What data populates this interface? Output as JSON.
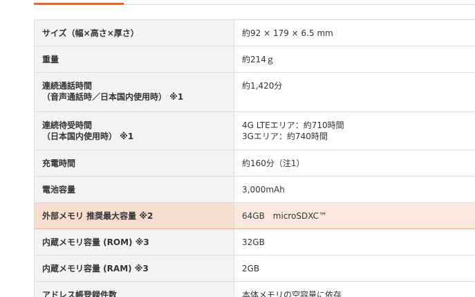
{
  "spec_rows": [
    {
      "label": [
        "サイズ（幅×高さ×厚さ）"
      ],
      "value": [
        "約92 × 179 × 6.5 mm"
      ]
    },
    {
      "label": [
        "重量"
      ],
      "value": [
        "約214ｇ"
      ]
    },
    {
      "label": [
        "連続通話時間",
        "（音声通話時／日本国内使用時） ※1"
      ],
      "value": [
        "約1,420分"
      ]
    },
    {
      "label": [
        "連続待受時間",
        "（日本国内使用時） ※1"
      ],
      "value": [
        "4G LTEエリア：約710時間",
        "3Gエリア：約740時間"
      ]
    },
    {
      "label": [
        "充電時間"
      ],
      "value": [
        "約160分（注1）"
      ]
    },
    {
      "label": [
        "電池容量"
      ],
      "value": [
        "3,000mAh"
      ]
    },
    {
      "label": [
        "外部メモリ 推奨最大容量 ※2"
      ],
      "value": [
        "64GB　microSDXC™"
      ]
    },
    {
      "label": [
        "内蔵メモリ容量 (ROM) ※3"
      ],
      "value": [
        "32GB"
      ]
    },
    {
      "label": [
        "内蔵メモリ容量 (RAM) ※3"
      ],
      "value": [
        "2GB"
      ]
    },
    {
      "label": [
        "アドレス帳登録件数"
      ],
      "value": [
        "本体メモリの空容量に依存"
      ]
    }
  ],
  "colors": {
    "tab_accent": "#d9683a",
    "label_bg": "#f3f3f3",
    "highlight_label_bg": "#f7ddd0",
    "highlight_value_bg": "#fbe9e0",
    "border": "#dcdcdc"
  }
}
